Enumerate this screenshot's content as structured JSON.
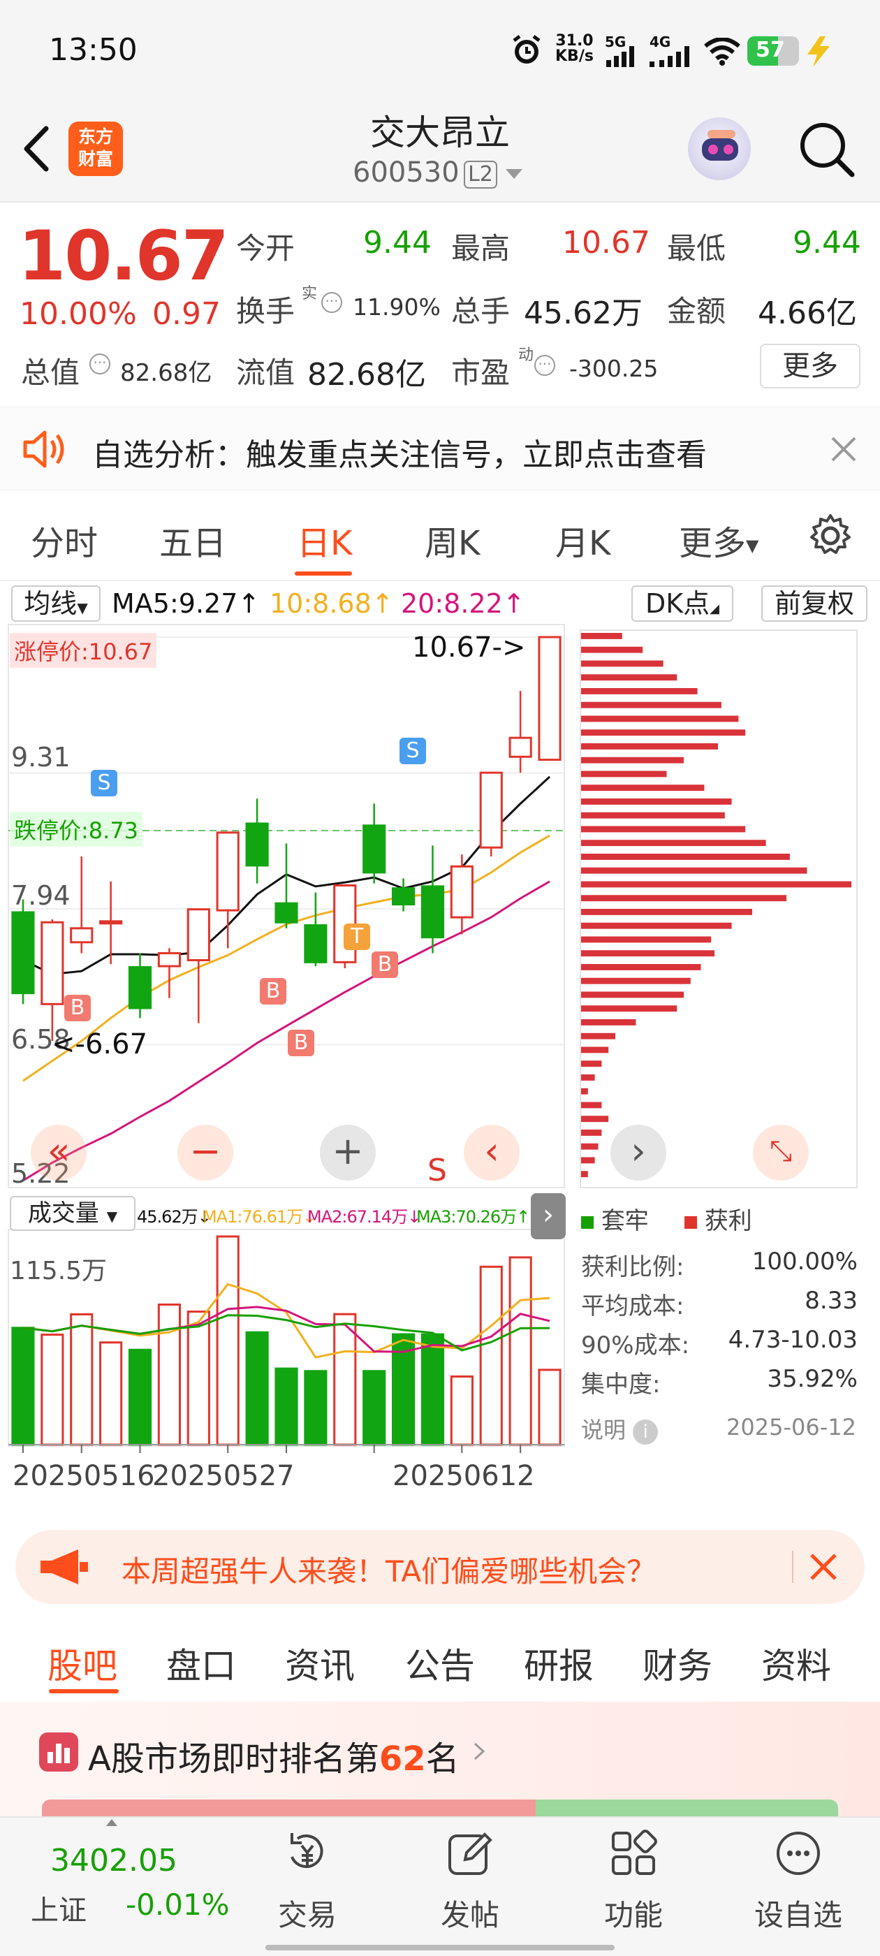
{
  "status": {
    "time": "13:50",
    "net_speed_value": "31.0",
    "net_speed_unit": "KB/s",
    "sim1": "5G",
    "sim2": "4G",
    "battery": "57"
  },
  "header": {
    "title": "交大昂立",
    "code": "600530",
    "level": "L2",
    "logo_line1": "东方",
    "logo_line2": "财富"
  },
  "quote": {
    "price": "10.67",
    "pct": "10.00%",
    "change": "0.97",
    "open_label": "今开",
    "open": "9.44",
    "high_label": "最高",
    "high": "10.67",
    "low_label": "最低",
    "low": "9.44",
    "turnover_label": "换手",
    "turnover_sup": "实",
    "turnover": "11.90%",
    "volume_label": "总手",
    "volume": "45.62万",
    "amount_label": "金额",
    "amount": "4.66亿",
    "mktcap_label": "总值",
    "mktcap": "82.68亿",
    "float_label": "流值",
    "float": "82.68亿",
    "pe_label": "市盈",
    "pe_sup": "动",
    "pe": "-300.25",
    "more": "更多"
  },
  "notice": {
    "text": "自选分析：触发重点关注信号，立即点击查看"
  },
  "period_tabs": [
    "分时",
    "五日",
    "日K",
    "周K",
    "月K",
    "更多"
  ],
  "chart": {
    "ma_select": "均线",
    "ma5": "MA5:9.27↑",
    "ma10": "10:8.68↑",
    "ma20": "20:8.22↑",
    "dk": "DK点",
    "adj": "前复权",
    "limit_up": "涨停价:10.67",
    "limit_down": "跌停价:8.73",
    "y1": "10.67",
    "y2": "9.31",
    "y3": "7.94",
    "y4": "6.58",
    "y5": "5.22",
    "hi_mark": "10.67->",
    "lo_mark": "<-6.67",
    "vol_select": "成交量",
    "vol_val": "45.62万↓",
    "vol_ma1": "MA1:76.61万↓",
    "vol_ma2": "MA2:67.14万↓",
    "vol_ma3": "MA3:70.26万↑",
    "vol_axis": "115.5万",
    "dates": [
      "20250516",
      "20250527",
      "20250612"
    ],
    "legend_trapped": "套牢",
    "legend_profit": "获利",
    "stats": [
      {
        "k": "获利比例:",
        "v": "100.00%"
      },
      {
        "k": "平均成本:",
        "v": "8.33"
      },
      {
        "k": "90%成本:",
        "v": "4.73-10.03"
      },
      {
        "k": "集中度:",
        "v": "35.92%"
      }
    ],
    "note_label": "说明",
    "note_date": "2025-06-12",
    "colors": {
      "up": "#e0352b",
      "down": "#12a512",
      "ma5": "#111111",
      "ma10": "#f2b01e",
      "ma20": "#d4147b"
    }
  },
  "chart_data": {
    "type": "candlestick",
    "dates": [
      "20250516",
      "20250527",
      "20250612"
    ],
    "candles": [
      {
        "o": 7.91,
        "c": 7.1,
        "h": 8.04,
        "l": 6.99
      },
      {
        "o": 6.99,
        "c": 7.81,
        "h": 7.84,
        "l": 6.62
      },
      {
        "o": 7.61,
        "c": 7.75,
        "h": 8.47,
        "l": 7.5
      },
      {
        "o": 7.82,
        "c": 7.82,
        "h": 8.22,
        "l": 7.39
      },
      {
        "o": 7.36,
        "c": 6.95,
        "h": 7.5,
        "l": 6.85
      },
      {
        "o": 7.37,
        "c": 7.5,
        "h": 7.55,
        "l": 7.05
      },
      {
        "o": 7.43,
        "c": 7.94,
        "h": 7.95,
        "l": 6.8
      },
      {
        "o": 7.93,
        "c": 8.71,
        "h": 8.71,
        "l": 7.55
      },
      {
        "o": 8.8,
        "c": 8.38,
        "h": 9.05,
        "l": 8.2
      },
      {
        "o": 8.0,
        "c": 7.81,
        "h": 8.6,
        "l": 7.75
      },
      {
        "o": 7.78,
        "c": 7.41,
        "h": 8.11,
        "l": 7.37
      },
      {
        "o": 7.41,
        "c": 8.18,
        "h": 8.19,
        "l": 7.35
      },
      {
        "o": 8.78,
        "c": 8.31,
        "h": 9.0,
        "l": 8.2
      },
      {
        "o": 8.15,
        "c": 7.99,
        "h": 8.25,
        "l": 7.92
      },
      {
        "o": 8.17,
        "c": 7.66,
        "h": 8.58,
        "l": 7.5
      },
      {
        "o": 7.86,
        "c": 8.37,
        "h": 8.49,
        "l": 7.69
      },
      {
        "o": 8.56,
        "c": 9.31,
        "h": 9.32,
        "l": 8.47
      },
      {
        "o": 9.47,
        "c": 9.66,
        "h": 10.13,
        "l": 9.31
      },
      {
        "o": 9.44,
        "c": 10.67,
        "h": 10.67,
        "l": 9.44
      }
    ],
    "volume": [
      64.8,
      61.0,
      72.3,
      56.7,
      52.6,
      77.7,
      73.8,
      115.5,
      62.3,
      42.2,
      40.8,
      72.4,
      40.8,
      61.2,
      61.2,
      37.8,
      98.7,
      103.9,
      41.5
    ],
    "ma5": [
      7.43,
      7.29,
      7.32,
      7.49,
      7.49,
      7.48,
      7.51,
      7.78,
      8.09,
      8.29,
      8.17,
      8.21,
      8.26,
      8.15,
      8.22,
      8.36,
      8.71,
      9.0,
      9.27
    ],
    "ma10": [
      6.22,
      6.42,
      6.62,
      6.85,
      7.06,
      7.23,
      7.36,
      7.48,
      7.64,
      7.79,
      7.88,
      7.95,
      8.01,
      8.07,
      8.09,
      8.14,
      8.31,
      8.51,
      8.68
    ],
    "ma20": [
      5.22,
      5.4,
      5.55,
      5.69,
      5.86,
      6.02,
      6.21,
      6.4,
      6.6,
      6.77,
      6.94,
      7.11,
      7.27,
      7.42,
      7.57,
      7.71,
      7.86,
      8.05,
      8.22
    ],
    "y_range": [
      5.22,
      10.67
    ]
  },
  "ad": {
    "text": "本周超强牛人来袭！TA们偏爱哪些机会？"
  },
  "lower_tabs": [
    "股吧",
    "盘口",
    "资讯",
    "公告",
    "研报",
    "财务",
    "资料"
  ],
  "rank": {
    "prefix": "A股市场即时排名第",
    "num": "62",
    "suffix": "名"
  },
  "bottom": {
    "index_value": "3402.05",
    "index_name": "上证",
    "index_pct": "-0.01%",
    "items": [
      "交易",
      "发帖",
      "功能",
      "设自选"
    ]
  }
}
